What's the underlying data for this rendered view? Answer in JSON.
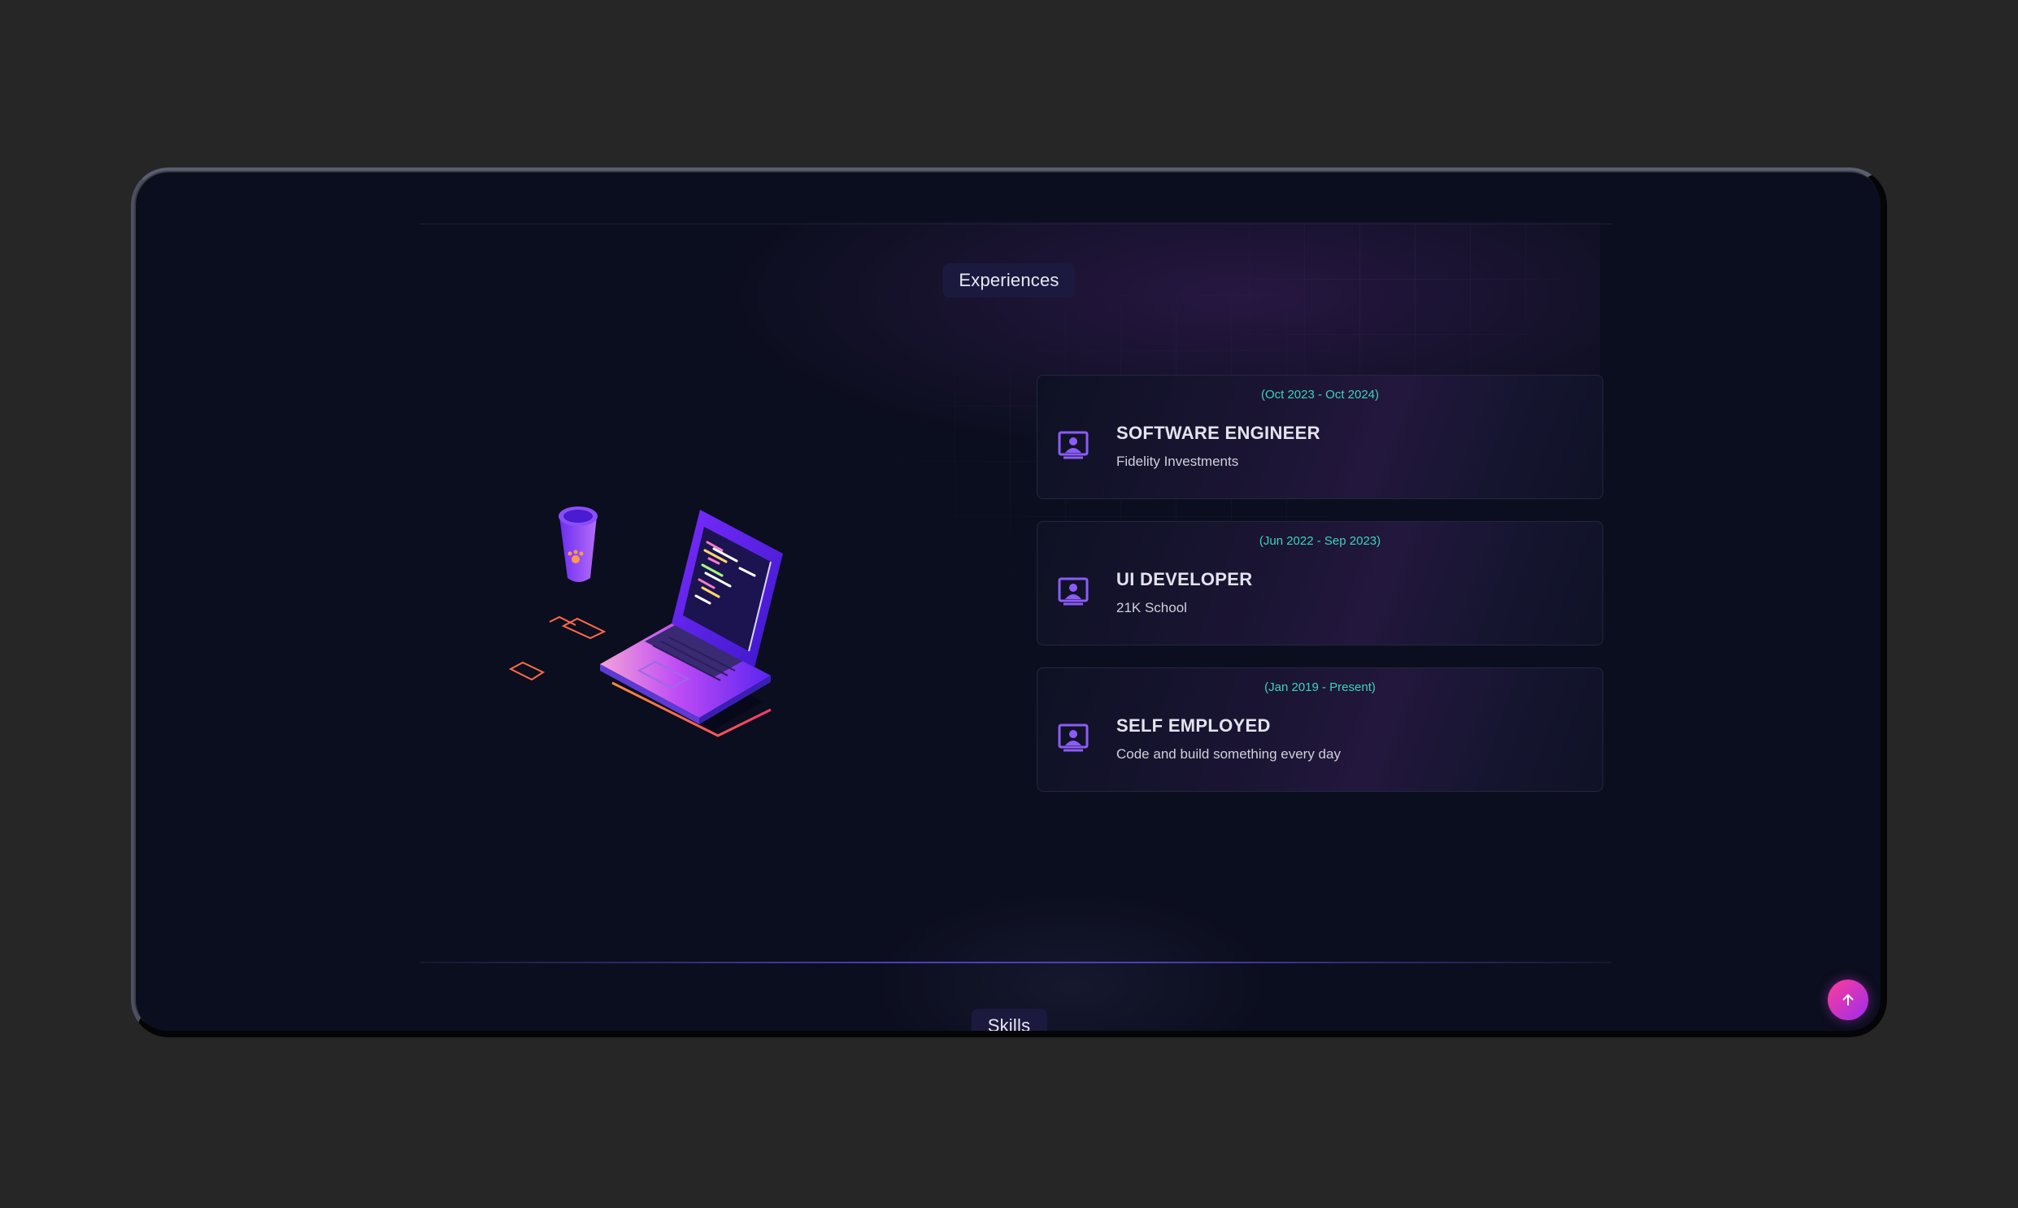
{
  "sections": {
    "experiences_label": "Experiences",
    "skills_label": "Skills"
  },
  "experiences": [
    {
      "date": "(Oct 2023 - Oct 2024)",
      "title": "SOFTWARE ENGINEER",
      "company": "Fidelity Investments"
    },
    {
      "date": "(Jun 2022 - Sep 2023)",
      "title": "UI DEVELOPER",
      "company": "21K School"
    },
    {
      "date": "(Jan 2019 - Present)",
      "title": "SELF EMPLOYED",
      "company": "Code and build something every day"
    }
  ],
  "icons": {
    "experience_icon": "user-badge-icon",
    "scroll_top_icon": "arrow-up-icon",
    "illustration": "laptop-and-cup-illustration"
  },
  "colors": {
    "accent_date": "#3ed3b8",
    "pill_bg": "#1b1a3e",
    "fab_start": "#ff3d96",
    "fab_end": "#9b2cf0",
    "icon_purple": "#8b5cf6"
  }
}
